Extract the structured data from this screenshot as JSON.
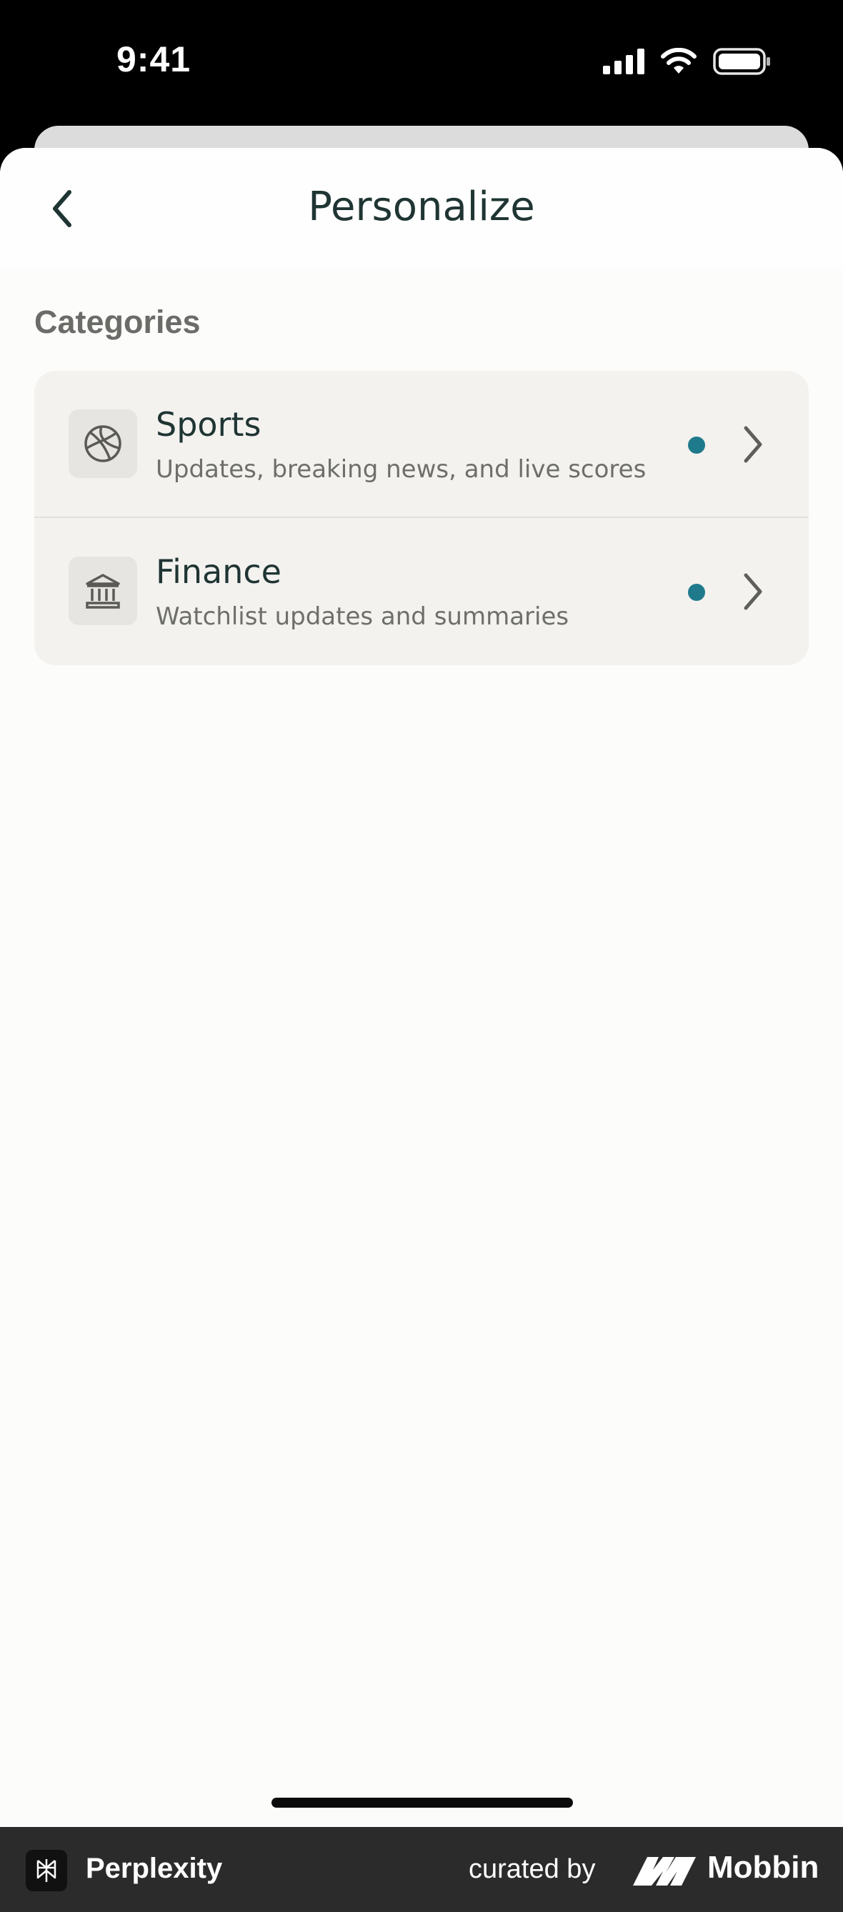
{
  "status_bar": {
    "time": "9:41",
    "icons": [
      "cellular-signal-icon",
      "wifi-icon",
      "battery-icon"
    ]
  },
  "header": {
    "title": "Personalize",
    "back_icon": "chevron-left-icon"
  },
  "categories": {
    "label": "Categories",
    "items": [
      {
        "title": "Sports",
        "subtitle": "Updates, breaking news, and live scores",
        "icon": "basketball-icon",
        "indicator_color": "#1f7a8c"
      },
      {
        "title": "Finance",
        "subtitle": "Watchlist updates and summaries",
        "icon": "bank-icon",
        "indicator_color": "#1f7a8c"
      }
    ]
  },
  "footer": {
    "app_name": "Perplexity",
    "curated_by": "curated by",
    "brand": "Mobbin"
  },
  "colors": {
    "accent": "#1f7a8c",
    "title_text": "#1f3533",
    "sheet_background": "#fcfcfb",
    "card_background": "#f3f2ef"
  }
}
